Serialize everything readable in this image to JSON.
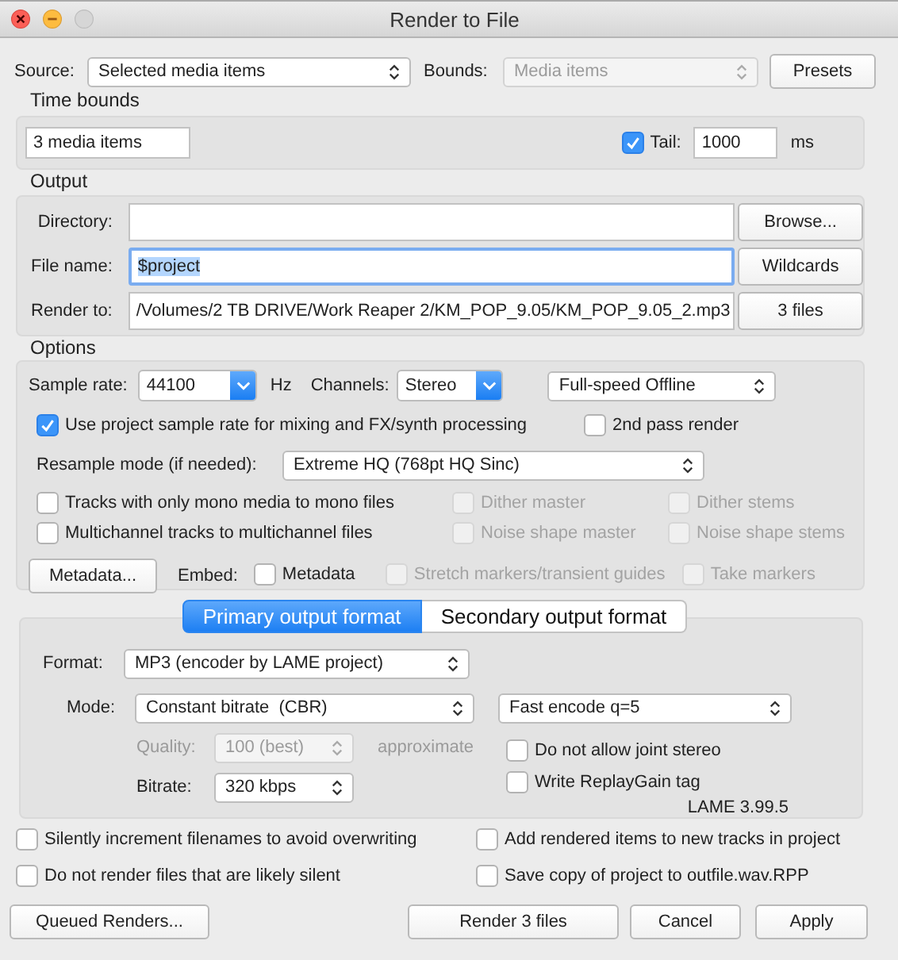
{
  "window": {
    "title": "Render to File"
  },
  "source": {
    "label": "Source:",
    "select": {
      "value": "Selected media items",
      "disabled": false
    }
  },
  "bounds": {
    "label": "Bounds:",
    "select": {
      "value": "Media items",
      "disabled": true
    }
  },
  "presets_button": "Presets",
  "time_bounds": {
    "heading": "Time bounds",
    "value": "3 media items",
    "tail": {
      "label": "Tail:",
      "checked": true,
      "disabled": false
    },
    "tail_value": "1000",
    "tail_unit": "ms"
  },
  "output": {
    "heading": "Output",
    "rows": [
      {
        "label": "Directory:",
        "focused": false,
        "button": "Browse..."
      },
      {
        "label": "File name:",
        "value": "$project",
        "focused": true,
        "button": "Wildcards"
      },
      {
        "label": "Render to:",
        "value": "/Volumes/2 TB DRIVE/Work Reaper 2/KM_POP_9.05/KM_POP_9.05_2.mp3",
        "focused": false,
        "button": "3 files"
      }
    ]
  },
  "options": {
    "heading": "Options",
    "sample_rate": {
      "label": "Sample rate:",
      "value": "44100",
      "unit": "Hz"
    },
    "channels": {
      "label": "Channels:",
      "value": "Stereo"
    },
    "speed": {
      "value": "Full-speed Offline"
    },
    "project_rate": {
      "label": "Use project sample rate for mixing and FX/synth processing",
      "checked": true,
      "disabled": false
    },
    "second_pass": {
      "label": "2nd pass render",
      "checked": false,
      "disabled": false
    },
    "resample": {
      "label": "Resample mode (if needed):",
      "value": "Extreme HQ (768pt HQ Sinc)"
    },
    "checkbox_rows": [
      [
        {
          "label": "Tracks with only mono media to mono files",
          "checked": false,
          "disabled": false
        },
        {
          "label": "Dither master",
          "checked": false,
          "disabled": true
        },
        {
          "label": "Dither stems",
          "checked": false,
          "disabled": true
        }
      ],
      [
        {
          "label": "Multichannel tracks to multichannel files",
          "checked": false,
          "disabled": false
        },
        {
          "label": "Noise shape master",
          "checked": false,
          "disabled": true
        },
        {
          "label": "Noise shape stems",
          "checked": false,
          "disabled": true
        }
      ]
    ],
    "metadata_button": "Metadata...",
    "embed": {
      "label": "Embed:",
      "items": [
        {
          "label": "Metadata",
          "checked": false,
          "disabled": false
        },
        {
          "label": "Stretch markers/transient guides",
          "checked": false,
          "disabled": true
        },
        {
          "label": "Take markers",
          "checked": false,
          "disabled": true
        }
      ]
    }
  },
  "format_tabs": [
    {
      "label": "Primary output format",
      "selected": true
    },
    {
      "label": "Secondary output format",
      "selected": false
    }
  ],
  "format": {
    "format": {
      "label": "Format:",
      "value": "MP3 (encoder by LAME project)"
    },
    "mode": {
      "label": "Mode:",
      "value": "Constant bitrate  (CBR)"
    },
    "encode": {
      "value": "Fast encode q=5"
    },
    "quality": {
      "label": "Quality:",
      "value": "100 (best)",
      "disabled": true,
      "note": "approximate"
    },
    "bitrate": {
      "label": "Bitrate:",
      "value": "320 kbps"
    },
    "checkboxes": [
      {
        "label": "Do not allow joint stereo",
        "checked": false,
        "disabled": false
      },
      {
        "label": "Write ReplayGain tag",
        "checked": false,
        "disabled": false
      }
    ],
    "version": "LAME 3.99.5"
  },
  "bottom_checkboxes": [
    {
      "label": "Silently increment filenames to avoid overwriting",
      "checked": false,
      "disabled": false
    },
    {
      "label": "Add rendered items to new tracks in project",
      "checked": false,
      "disabled": false
    },
    {
      "label": "Do not render files that are likely silent",
      "checked": false,
      "disabled": false
    },
    {
      "label": "Save copy of project to outfile.wav.RPP",
      "checked": false,
      "disabled": false
    }
  ],
  "buttons": [
    "Queued Renders...",
    "Render 3 files",
    "Cancel",
    "Apply"
  ]
}
